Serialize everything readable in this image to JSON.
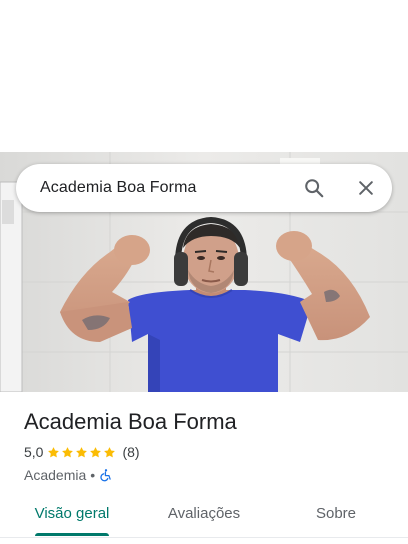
{
  "search": {
    "query": "Academia Boa Forma"
  },
  "icons": {
    "search": "search-icon",
    "close": "close-icon",
    "star": "star-icon",
    "accessibility": "wheelchair-accessible-icon"
  },
  "place": {
    "name": "Academia Boa Forma",
    "rating": "5,0",
    "stars_filled": 5,
    "stars_total": 5,
    "review_count": "(8)",
    "category": "Academia",
    "separator": "•"
  },
  "tabs": [
    {
      "label": "Visão geral",
      "selected": true
    },
    {
      "label": "Avaliações",
      "selected": false
    },
    {
      "label": "Sobre",
      "selected": false
    }
  ],
  "colors": {
    "accent": "#00796b",
    "star": "#fbbc04",
    "accessibility_icon": "#1a73e8",
    "text_primary": "#202124",
    "text_secondary": "#5f6368"
  }
}
